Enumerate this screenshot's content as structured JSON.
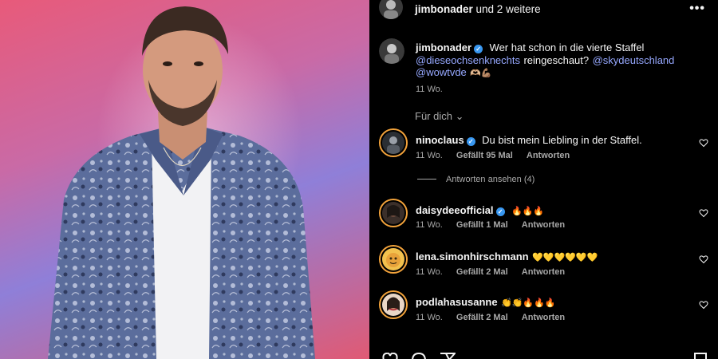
{
  "header": {
    "username": "jimbonader",
    "suffix": "und 2 weitere",
    "more_icon": "more-horizontal-icon"
  },
  "post": {
    "username": "jimbonader",
    "caption_text": "Wer hat schon in die vierte Staffel",
    "mention_1": "@dieseochsenknechts",
    "caption_text_2": "reingeschaut?",
    "mention_2": "@skydeutschland",
    "mention_3": "@wowtvde",
    "caption_emojis": "🫶🏼💪🏽",
    "time": "11 Wo."
  },
  "filter": {
    "label": "Für dich",
    "chevron_icon": "chevron-down-icon"
  },
  "comments": [
    {
      "username": "ninoclaus",
      "verified": true,
      "text": "Du bist mein Liebling in der Staffel.",
      "time": "11 Wo.",
      "likes": "Gefällt 95 Mal",
      "reply": "Antworten"
    },
    {
      "username": "daisydeeofficial",
      "verified": true,
      "text": "🔥🔥🔥",
      "time": "11 Wo.",
      "likes": "Gefällt 1 Mal",
      "reply": "Antworten"
    },
    {
      "username": "lena.simonhirschmann",
      "verified": false,
      "text": "💛💛💛💛💛💛",
      "time": "11 Wo.",
      "likes": "Gefällt 2 Mal",
      "reply": "Antworten"
    },
    {
      "username": "podlahasusanne",
      "verified": false,
      "text": "👏👏🔥🔥🔥",
      "time": "11 Wo.",
      "likes": "Gefällt 2 Mal",
      "reply": "Antworten"
    }
  ],
  "view_replies": "Antworten ansehen (4)",
  "colors": {
    "background": "#000000",
    "text": "#f5f5f5",
    "muted": "#a8a8a8",
    "mention": "#96a8ff",
    "verified": "#3897f0"
  }
}
